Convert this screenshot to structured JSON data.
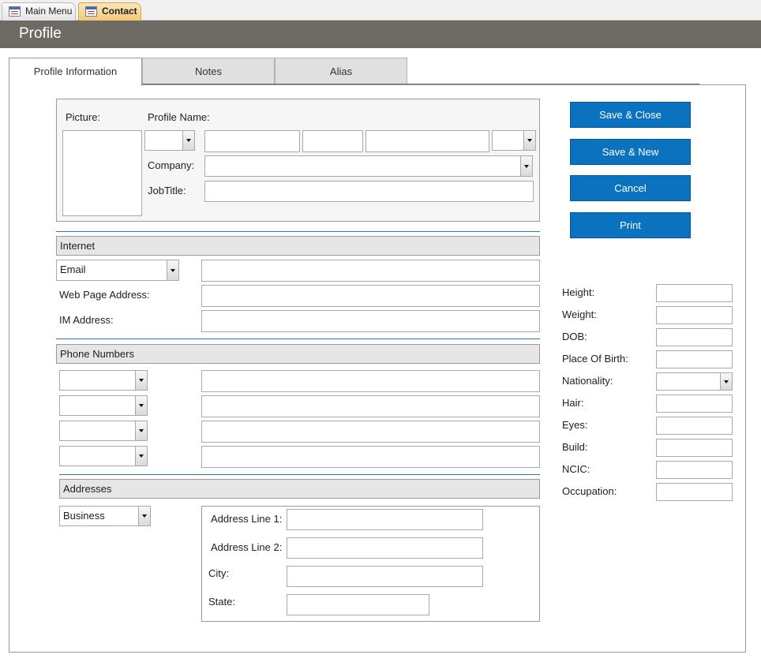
{
  "doc_tabs": [
    {
      "label": "Main Menu",
      "active": false
    },
    {
      "label": "Contact",
      "active": true
    }
  ],
  "header": {
    "title": "Profile"
  },
  "page_tabs": [
    {
      "label": "Profile Information",
      "active": true
    },
    {
      "label": "Notes",
      "active": false
    },
    {
      "label": "Alias",
      "active": false
    }
  ],
  "profile": {
    "picture_label": "Picture:",
    "profile_name_label": "Profile Name:",
    "company_label": "Company:",
    "jobtitle_label": "JobTitle:"
  },
  "buttons": {
    "save_close": "Save & Close",
    "save_new": "Save & New",
    "cancel": "Cancel",
    "print": "Print"
  },
  "internet": {
    "section_title": "Internet",
    "email_type": "Email",
    "web_page_label": "Web Page Address:",
    "im_label": "IM Address:"
  },
  "phone": {
    "section_title": "Phone Numbers"
  },
  "addresses": {
    "section_title": "Addresses",
    "address_type": "Business",
    "line1_label": "Address Line 1:",
    "line2_label": "Address Line 2:",
    "city_label": "City:",
    "state_label": "State:"
  },
  "physical": {
    "height": "Height:",
    "weight": "Weight:",
    "dob": "DOB:",
    "place_of_birth": "Place Of Birth:",
    "nationality": "Nationality:",
    "hair": "Hair:",
    "eyes": "Eyes:",
    "build": "Build:",
    "ncic": "NCIC:",
    "occupation": "Occupation:"
  },
  "colors": {
    "header_bg": "#6e6a64",
    "button_bg": "#0b72bf",
    "section_line": "#2e79b9",
    "active_doc_tab": "#f6c878"
  }
}
